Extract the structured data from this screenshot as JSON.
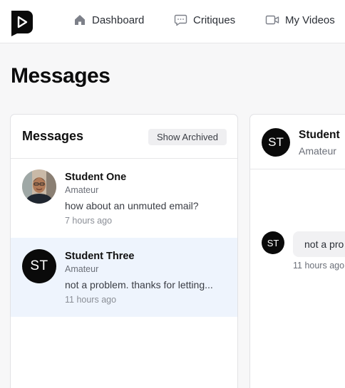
{
  "nav": {
    "items": [
      {
        "label": "Dashboard",
        "icon": "home-icon"
      },
      {
        "label": "Critiques",
        "icon": "chat-icon"
      },
      {
        "label": "My Videos",
        "icon": "video-icon"
      }
    ]
  },
  "page": {
    "title": "Messages"
  },
  "messages_panel": {
    "title": "Messages",
    "show_archived_label": "Show Archived",
    "threads": [
      {
        "name": "Student One",
        "role": "Amateur",
        "preview": "how about an unmuted email?",
        "time": "7 hours ago",
        "avatar": "photo",
        "active": false
      },
      {
        "name": "Student Three",
        "role": "Amateur",
        "preview": "not a problem. thanks for letting...",
        "time": "11 hours ago",
        "avatar_initials": "ST",
        "active": true
      }
    ]
  },
  "conversation": {
    "name": "Student",
    "role": "Amateur",
    "avatar_initials": "ST",
    "message": {
      "sender_initials": "ST",
      "text": "not a pro",
      "time": "11 hours ago"
    }
  },
  "colors": {
    "active_thread_bg": "#eef4fd",
    "avatar_bg": "#0a0a0a",
    "page_bg": "#f7f7f8"
  }
}
